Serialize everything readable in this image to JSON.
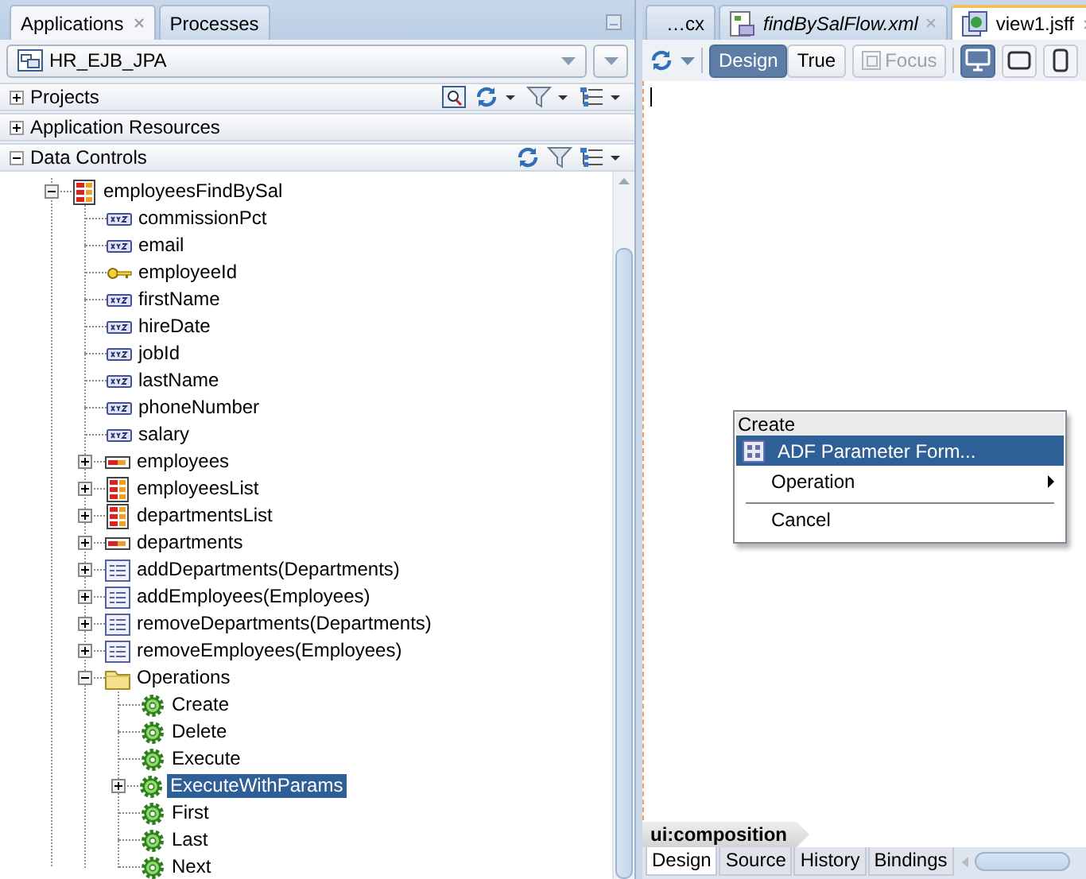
{
  "left_panel": {
    "tabs": [
      {
        "label": "Applications",
        "selected": true,
        "closable": true
      },
      {
        "label": "Processes",
        "selected": false,
        "closable": false
      }
    ],
    "application_selector": {
      "value": "HR_EJB_JPA"
    },
    "sections": [
      {
        "title": "Projects",
        "expanded": false,
        "kind": "projects"
      },
      {
        "title": "Application Resources",
        "expanded": false,
        "kind": "plain"
      },
      {
        "title": "Data Controls",
        "expanded": true,
        "kind": "data"
      }
    ],
    "tree": [
      {
        "label": "employeesFindBySal",
        "kind": "collection",
        "expanded": true,
        "selected": false,
        "children": [
          {
            "label": "commissionPct",
            "kind": "attribute",
            "selected": false
          },
          {
            "label": "email",
            "kind": "attribute",
            "selected": false
          },
          {
            "label": "employeeId",
            "kind": "key",
            "selected": false
          },
          {
            "label": "firstName",
            "kind": "attribute",
            "selected": false
          },
          {
            "label": "hireDate",
            "kind": "attribute",
            "selected": false
          },
          {
            "label": "jobId",
            "kind": "attribute",
            "selected": false
          },
          {
            "label": "lastName",
            "kind": "attribute",
            "selected": false
          },
          {
            "label": "phoneNumber",
            "kind": "attribute",
            "selected": false
          },
          {
            "label": "salary",
            "kind": "attribute",
            "selected": false
          },
          {
            "label": "employees",
            "kind": "accessor",
            "expanded": false,
            "selected": false
          },
          {
            "label": "employeesList",
            "kind": "collection",
            "expanded": false,
            "selected": false
          },
          {
            "label": "departmentsList",
            "kind": "collection",
            "expanded": false,
            "selected": false
          },
          {
            "label": "departments",
            "kind": "accessor",
            "expanded": false,
            "selected": false
          },
          {
            "label": "addDepartments(Departments)",
            "kind": "method",
            "expanded": false,
            "selected": false
          },
          {
            "label": "addEmployees(Employees)",
            "kind": "method",
            "expanded": false,
            "selected": false
          },
          {
            "label": "removeDepartments(Departments)",
            "kind": "method",
            "expanded": false,
            "selected": false
          },
          {
            "label": "removeEmployees(Employees)",
            "kind": "method",
            "expanded": false,
            "selected": false
          },
          {
            "label": "Operations",
            "kind": "folder",
            "expanded": true,
            "selected": false,
            "children": [
              {
                "label": "Create",
                "kind": "operation",
                "selected": false
              },
              {
                "label": "Delete",
                "kind": "operation",
                "selected": false
              },
              {
                "label": "Execute",
                "kind": "operation",
                "selected": false
              },
              {
                "label": "ExecuteWithParams",
                "kind": "operation",
                "expanded": false,
                "selected": true
              },
              {
                "label": "First",
                "kind": "operation",
                "selected": false
              },
              {
                "label": "Last",
                "kind": "operation",
                "selected": false
              },
              {
                "label": "Next",
                "kind": "operation",
                "selected": false
              }
            ]
          }
        ]
      }
    ]
  },
  "editor": {
    "tabs": [
      {
        "label": "…cx",
        "selected": false,
        "closable": false,
        "preview": false,
        "kind": "plain"
      },
      {
        "label": "findBySalFlow.xml",
        "selected": false,
        "closable": true,
        "preview": true,
        "kind": "flow"
      },
      {
        "label": "view1.jsff",
        "selected": true,
        "closable": true,
        "preview": false,
        "kind": "page"
      }
    ],
    "toolbar": {
      "buttons": [
        {
          "label": "Design",
          "selected": true,
          "disabled": false
        },
        {
          "label": "True",
          "selected": false,
          "disabled": false
        },
        {
          "label": "Focus",
          "selected": false,
          "disabled": true
        }
      ],
      "devices": [
        {
          "kind": "desktop",
          "selected": true
        },
        {
          "kind": "tablet",
          "selected": false
        },
        {
          "kind": "phone",
          "selected": false
        }
      ]
    },
    "context_menu": {
      "header": "Create",
      "items": [
        {
          "label": "ADF Parameter Form...",
          "selected": true,
          "submenu": false,
          "separator_before": false,
          "icon": true
        },
        {
          "label": "Operation",
          "selected": false,
          "submenu": true,
          "separator_before": false,
          "icon": false
        },
        {
          "label": "Cancel",
          "selected": false,
          "submenu": false,
          "separator_before": true,
          "icon": false
        }
      ]
    },
    "breadcrumb": "ui:composition",
    "bottom_tabs": [
      {
        "label": "Design",
        "selected": true
      },
      {
        "label": "Source",
        "selected": false
      },
      {
        "label": "History",
        "selected": false
      },
      {
        "label": "Bindings",
        "selected": false
      }
    ]
  }
}
